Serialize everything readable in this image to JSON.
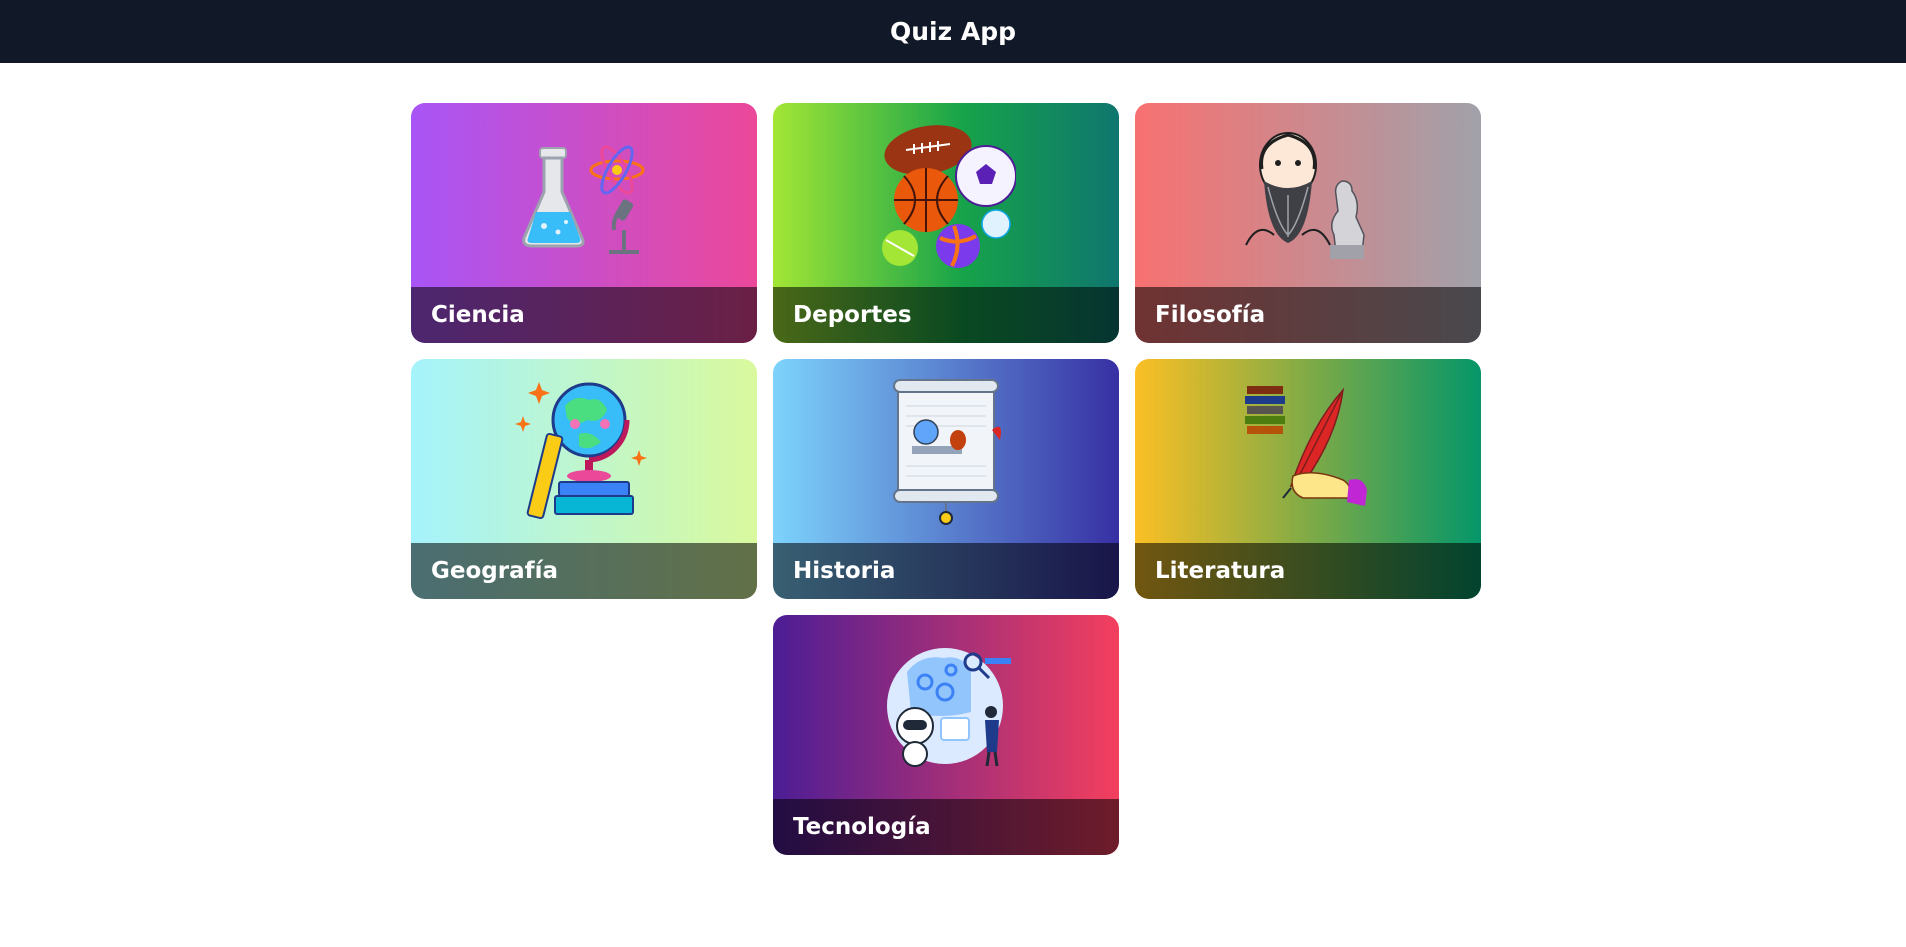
{
  "app": {
    "title": "Quiz App"
  },
  "categories": [
    {
      "label": "Ciencia",
      "icon": "science-flask-icon"
    },
    {
      "label": "Deportes",
      "icon": "sports-balls-icon"
    },
    {
      "label": "Filosofía",
      "icon": "philosopher-icon"
    },
    {
      "label": "Geografía",
      "icon": "globe-icon"
    },
    {
      "label": "Historia",
      "icon": "scroll-icon"
    },
    {
      "label": "Literatura",
      "icon": "quill-icon"
    },
    {
      "label": "Tecnología",
      "icon": "technology-robot-icon"
    }
  ]
}
